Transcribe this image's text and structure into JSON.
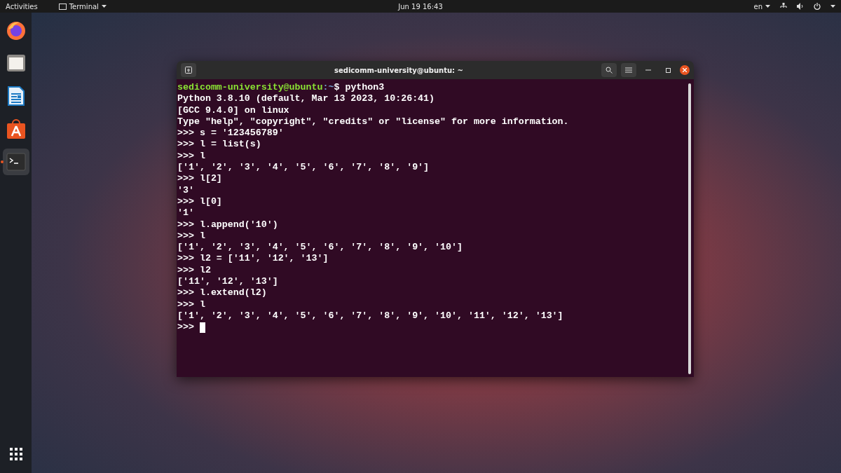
{
  "top_bar": {
    "activities": "Activities",
    "app_menu": "Terminal",
    "clock": "Jun 19  16:43",
    "keyboard_layout": "en"
  },
  "dock": {
    "items": [
      {
        "kind": "firefox",
        "running": false
      },
      {
        "kind": "files",
        "running": false
      },
      {
        "kind": "writer",
        "running": false
      },
      {
        "kind": "software",
        "running": false
      },
      {
        "kind": "terminal",
        "running": true
      }
    ]
  },
  "terminal": {
    "title": "sedicomm-university@ubuntu: ~",
    "lines": [
      {
        "kind": "prompt",
        "user": "sedicomm-university@ubuntu",
        "path": ":~",
        "command": "$ python3"
      },
      {
        "kind": "output",
        "text": "Python 3.8.10 (default, Mar 13 2023, 10:26:41)"
      },
      {
        "kind": "output",
        "text": "[GCC 9.4.0] on linux"
      },
      {
        "kind": "output",
        "text": "Type \"help\", \"copyright\", \"credits\" or \"license\" for more information."
      },
      {
        "kind": "output",
        "text": ">>> s = '123456789'"
      },
      {
        "kind": "output",
        "text": ">>> l = list(s)"
      },
      {
        "kind": "output",
        "text": ">>> l"
      },
      {
        "kind": "output",
        "text": "['1', '2', '3', '4', '5', '6', '7', '8', '9']"
      },
      {
        "kind": "output",
        "text": ">>> l[2]"
      },
      {
        "kind": "output",
        "text": "'3'"
      },
      {
        "kind": "output",
        "text": ">>> l[0]"
      },
      {
        "kind": "output",
        "text": "'1'"
      },
      {
        "kind": "output",
        "text": ">>> l.append('10')"
      },
      {
        "kind": "output",
        "text": ">>> l"
      },
      {
        "kind": "output",
        "text": "['1', '2', '3', '4', '5', '6', '7', '8', '9', '10']"
      },
      {
        "kind": "output",
        "text": ">>> l2 = ['11', '12', '13']"
      },
      {
        "kind": "output",
        "text": ">>> l2"
      },
      {
        "kind": "output",
        "text": "['11', '12', '13']"
      },
      {
        "kind": "output",
        "text": ">>> l.extend(l2)"
      },
      {
        "kind": "output",
        "text": ">>> l"
      },
      {
        "kind": "output",
        "text": "['1', '2', '3', '4', '5', '6', '7', '8', '9', '10', '11', '12', '13']"
      },
      {
        "kind": "input",
        "text": ">>> "
      }
    ]
  }
}
